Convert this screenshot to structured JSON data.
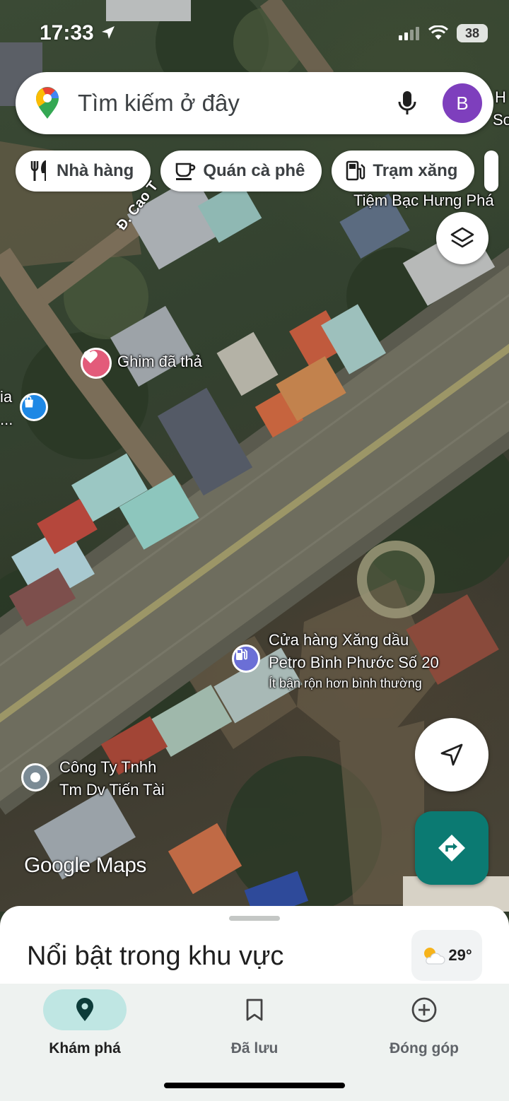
{
  "status_bar": {
    "time": "17:33",
    "battery": "38"
  },
  "search": {
    "placeholder": "Tìm kiếm ở đây",
    "avatar_letter": "B"
  },
  "chips": [
    {
      "icon": "restaurant-icon",
      "label": "Nhà hàng"
    },
    {
      "icon": "coffee-icon",
      "label": "Quán cà phê"
    },
    {
      "icon": "gas-station-icon",
      "label": "Trạm xăng"
    }
  ],
  "map": {
    "road_label": "Đ. Cao T",
    "edge_label_top": "H",
    "edge_label_top2": "Sơ",
    "edge_label_left": "ia",
    "edge_label_left2": "...",
    "places": [
      {
        "id": "tiem-bac",
        "name": "Tiệm Bạc Hưng Phá"
      },
      {
        "id": "dropped-pin",
        "name": "Ghim đã thả",
        "icon": "heart-icon"
      },
      {
        "id": "gas-station",
        "name_line1": "Cửa hàng Xăng dầu",
        "name_line2": "Petro Bình Phước Số 20",
        "subtitle": "Ít bận rộn hơn bình thường",
        "icon": "gas-pump-icon"
      },
      {
        "id": "company",
        "name_line1": "Công Ty Tnhh",
        "name_line2": "Tm Dv Tiến Tài",
        "icon": "place-icon"
      }
    ],
    "watermark": "Google Maps"
  },
  "sheet": {
    "title": "Nổi bật trong khu vực",
    "temperature": "29°"
  },
  "nav": [
    {
      "label": "Khám phá",
      "icon": "location-pin-icon",
      "active": true
    },
    {
      "label": "Đã lưu",
      "icon": "bookmark-icon",
      "active": false
    },
    {
      "label": "Đóng góp",
      "icon": "add-circle-icon",
      "active": false
    }
  ],
  "colors": {
    "accent_teal": "#0b7a72",
    "avatar_purple": "#7e3fbd",
    "nav_active_pill": "#bfe6e3"
  }
}
